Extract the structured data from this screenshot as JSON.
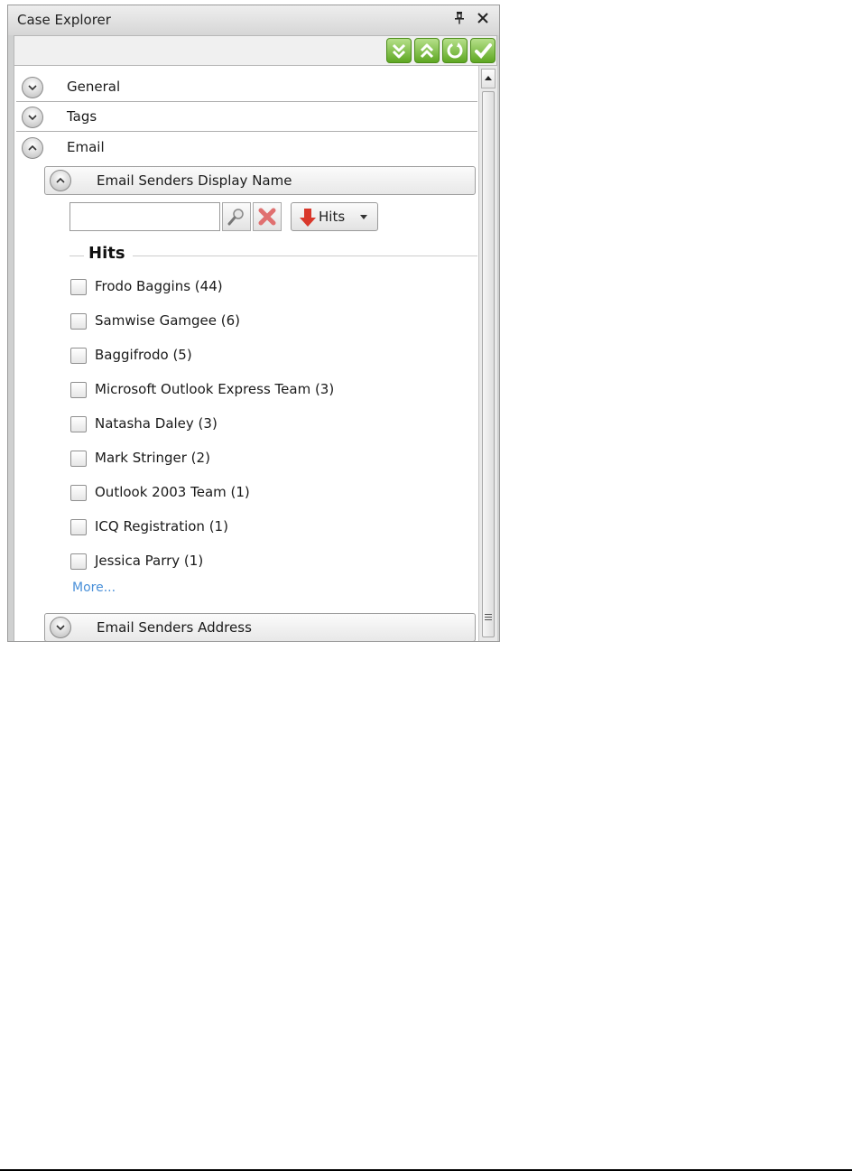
{
  "window": {
    "title": "Case Explorer",
    "pin_glyph": "p",
    "close_glyph": "✕"
  },
  "toolbar": {
    "buttons": [
      {
        "icon": "expand-all-icon"
      },
      {
        "icon": "collapse-all-icon"
      },
      {
        "icon": "refresh-icon"
      },
      {
        "icon": "apply-checkmark-icon"
      }
    ],
    "accent_color": "#5ea722"
  },
  "sections": [
    {
      "label": "General",
      "expanded": false
    },
    {
      "label": "Tags",
      "expanded": false
    },
    {
      "label": "Email",
      "expanded": true
    }
  ],
  "email": {
    "display_name_header": "Email Senders Display Name",
    "search": {
      "value": "",
      "placeholder": ""
    },
    "sort_label": "Hits",
    "group_title": "Hits",
    "hits": [
      {
        "label": "Frodo Baggins (44)",
        "checked": false
      },
      {
        "label": "Samwise Gamgee (6)",
        "checked": false
      },
      {
        "label": "Baggifrodo (5)",
        "checked": false
      },
      {
        "label": "Microsoft Outlook Express Team (3)",
        "checked": false
      },
      {
        "label": "Natasha Daley (3)",
        "checked": false
      },
      {
        "label": "Mark Stringer (2)",
        "checked": false
      },
      {
        "label": "Outlook 2003 Team (1)",
        "checked": false
      },
      {
        "label": "ICQ Registration (1)",
        "checked": false
      },
      {
        "label": "Jessica Parry (1)",
        "checked": false
      }
    ],
    "more_label": "More...",
    "address_header": "Email Senders Address"
  }
}
